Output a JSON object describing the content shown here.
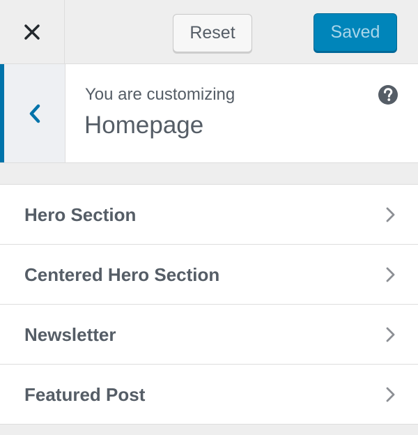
{
  "header": {
    "close_icon": "close-icon",
    "reset_label": "Reset",
    "saved_label": "Saved",
    "accent_color": "#0085ba"
  },
  "context": {
    "back_icon": "chevron-left-icon",
    "subtitle": "You are customizing",
    "title": "Homepage",
    "help_icon": "help-icon",
    "accent_color": "#0073aa"
  },
  "sections": {
    "items": [
      {
        "label": "Hero Section",
        "icon": "chevron-right-icon"
      },
      {
        "label": "Centered Hero Section",
        "icon": "chevron-right-icon"
      },
      {
        "label": "Newsletter",
        "icon": "chevron-right-icon"
      },
      {
        "label": "Featured Post",
        "icon": "chevron-right-icon"
      }
    ]
  }
}
